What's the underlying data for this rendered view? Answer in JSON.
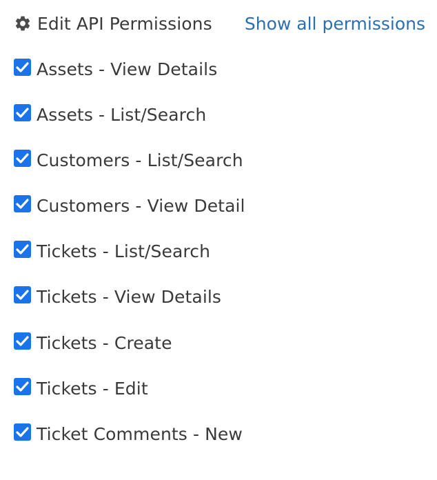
{
  "header": {
    "title": "Edit API Permissions",
    "title_icon": "gear-icon",
    "show_all_label": "Show all permissions",
    "link_color": "#2a6fb4"
  },
  "colors": {
    "checkbox": "#1a73e8",
    "text": "#3a3a3a"
  },
  "permissions": [
    {
      "label": "Assets - View Details",
      "checked": true
    },
    {
      "label": "Assets - List/Search",
      "checked": true
    },
    {
      "label": "Customers - List/Search",
      "checked": true
    },
    {
      "label": "Customers - View Detail",
      "checked": true
    },
    {
      "label": "Tickets - List/Search",
      "checked": true
    },
    {
      "label": "Tickets - View Details",
      "checked": true
    },
    {
      "label": "Tickets - Create",
      "checked": true
    },
    {
      "label": "Tickets - Edit",
      "checked": true
    },
    {
      "label": "Ticket Comments - New",
      "checked": true
    }
  ]
}
